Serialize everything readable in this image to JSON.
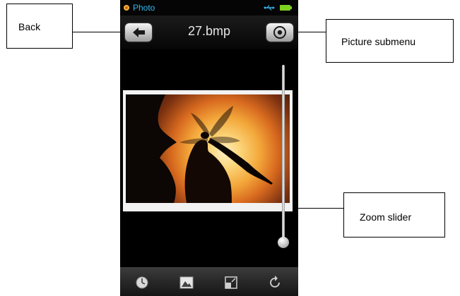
{
  "status": {
    "app_name": "Photo"
  },
  "header": {
    "title": "27.bmp"
  },
  "callouts": {
    "back": "Back",
    "submenu": "Picture submenu",
    "zoom": "Zoom slider"
  },
  "zoom": {
    "level": 0
  },
  "icons": {
    "back": "arrow-left-icon",
    "submenu": "gear-icon",
    "tools": [
      "slideshow-icon",
      "picture-icon",
      "resize-icon",
      "rotate-icon"
    ]
  }
}
